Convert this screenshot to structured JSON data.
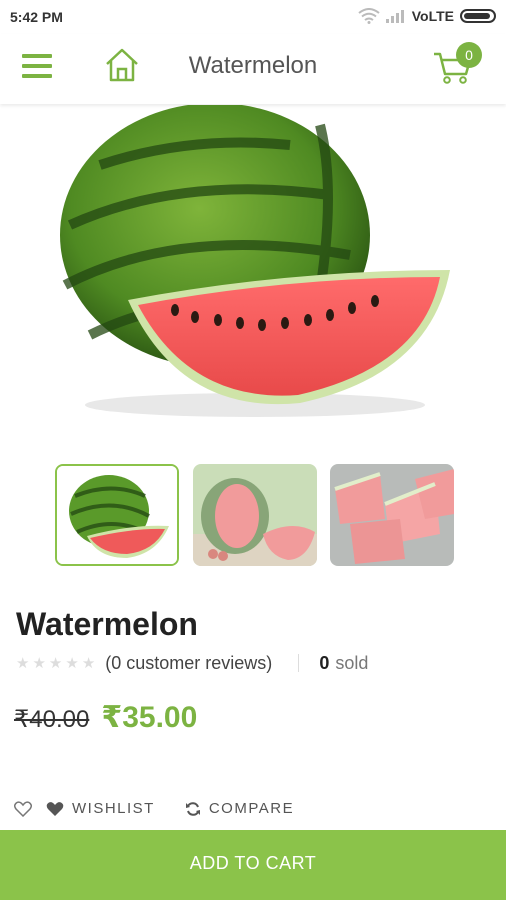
{
  "status_bar": {
    "time": "5:42 PM",
    "carrier": "VoLTE"
  },
  "header": {
    "title": "Watermelon",
    "cart_count": "0"
  },
  "product": {
    "name": "Watermelon",
    "reviews": "(0 customer reviews)",
    "sold_count": "0",
    "sold_label": "sold",
    "old_price": "₹40.00",
    "new_price": "₹35.00"
  },
  "actions": {
    "wishlist": "WISHLIST",
    "compare": "COMPARE"
  },
  "footer": {
    "add_to_cart": "ADD TO CART"
  },
  "colors": {
    "accent": "#8bc34a",
    "price": "#7cb342"
  },
  "icons": [
    "menu-icon",
    "home-icon",
    "cart-icon",
    "heart-outline-icon",
    "heart-icon",
    "refresh-icon",
    "star-icon",
    "wifi-icon",
    "signal-icon",
    "battery-icon"
  ]
}
